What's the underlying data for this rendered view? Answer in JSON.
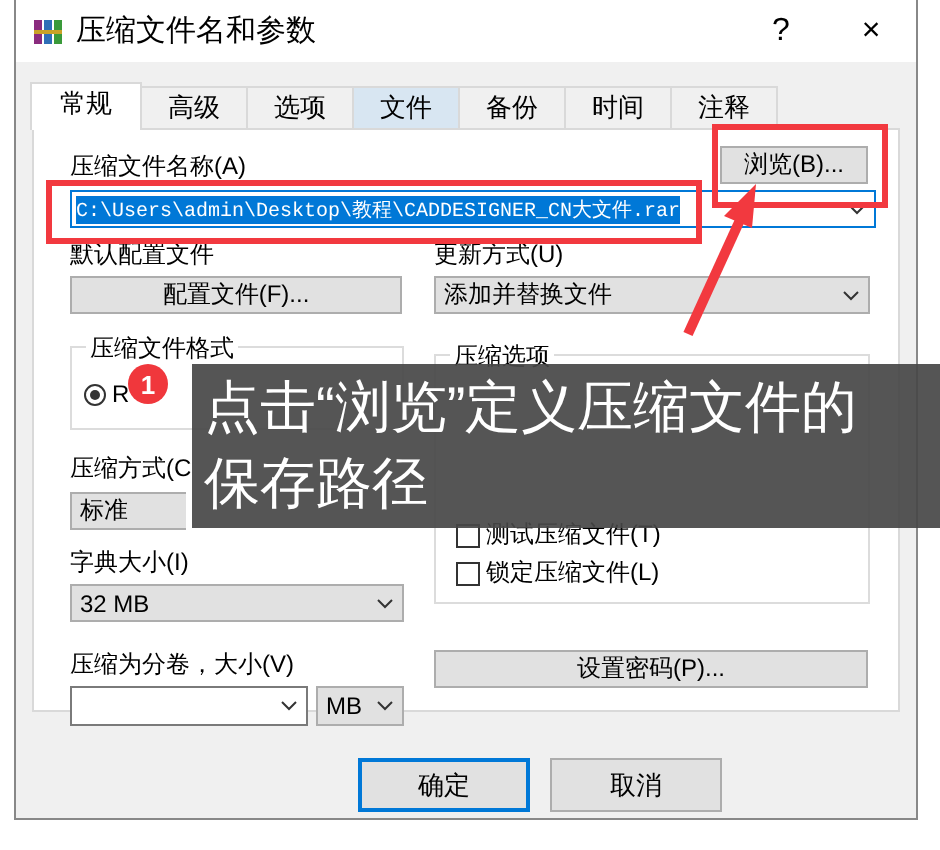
{
  "window": {
    "title": "压缩文件名和参数",
    "help": "?",
    "close": "×"
  },
  "tabs": [
    {
      "label": "常规",
      "selected": true,
      "highlighted": false
    },
    {
      "label": "高级",
      "selected": false,
      "highlighted": false
    },
    {
      "label": "选项",
      "selected": false,
      "highlighted": false
    },
    {
      "label": "文件",
      "selected": false,
      "highlighted": true
    },
    {
      "label": "备份",
      "selected": false,
      "highlighted": false
    },
    {
      "label": "时间",
      "selected": false,
      "highlighted": false
    },
    {
      "label": "注释",
      "selected": false,
      "highlighted": false
    }
  ],
  "archive_name": {
    "label": "压缩文件名称(A)",
    "value": "C:\\Users\\admin\\Desktop\\教程\\CADDESIGNER_CN大文件.rar",
    "browse_button": "浏览(B)..."
  },
  "profile": {
    "label": "默认配置文件",
    "button": "配置文件(F)..."
  },
  "update_mode": {
    "label": "更新方式(U)",
    "value": "添加并替换文件"
  },
  "format": {
    "label": "压缩文件格式",
    "options": [
      {
        "label": "R",
        "selected": true
      }
    ]
  },
  "method": {
    "label": "压缩方式(C",
    "value": "标准"
  },
  "dictionary": {
    "label": "字典大小(I)",
    "value": "32 MB"
  },
  "volumes": {
    "label": "压缩为分卷，大小(V)",
    "unit": "MB"
  },
  "options": {
    "label": "压缩选项",
    "items": [
      {
        "label": "测试压缩文件(T)",
        "checked": false
      },
      {
        "label": "锁定压缩文件(L)",
        "checked": false
      }
    ]
  },
  "password_button": "设置密码(P)...",
  "buttons": [
    {
      "label": "确定",
      "default": true
    },
    {
      "label": "取消",
      "default": false
    }
  ],
  "annotation": {
    "step": "1",
    "caption": "点击“浏览”定义压缩文件的保存路径"
  }
}
